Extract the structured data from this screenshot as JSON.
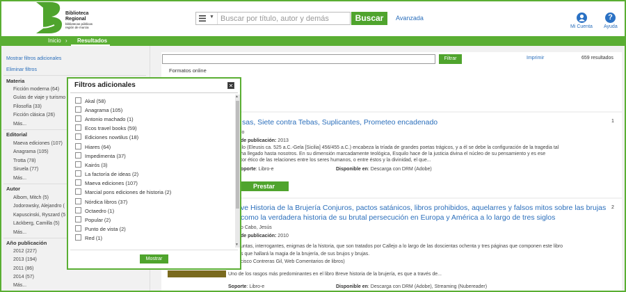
{
  "header": {
    "logo_line1": "Biblioteca",
    "logo_line2": "Regional",
    "logo_sub1": "bibliotecas públicas",
    "logo_sub2": "región de murcia",
    "search_placeholder": "Buscar por título, autor y demás",
    "search_button": "Buscar",
    "advanced": "Avanzada",
    "account": "Mi Cuenta",
    "help": "Ayuda",
    "help_glyph": "?"
  },
  "nav": {
    "home": "Inicio",
    "separator": "›",
    "results": "Resultados"
  },
  "sidebar": {
    "show_filters": "Mostrar filtros adicionales",
    "remove_filters": "Eliminar filtros",
    "sections": [
      {
        "title": "Materia",
        "items": [
          "Ficción moderna (64)",
          "Guías de viaje y turismo",
          "Filosofía (33)",
          "Ficción clásica (26)",
          "Más..."
        ]
      },
      {
        "title": "Editorial",
        "items": [
          "Maeva ediciones (107)",
          "Anagrama (105)",
          "Trotta (78)",
          "Siruela (77)",
          "Más..."
        ]
      },
      {
        "title": "Autor",
        "items": [
          "Albom, Mitch (5)",
          "Jodorowsky, Alejandro (",
          "Kapuscinski, Ryszard (5",
          "Läckberg, Camilla (5)",
          "Más..."
        ]
      },
      {
        "title": "Año publicación",
        "items": [
          "2012 (227)",
          "2013 (194)",
          "2011 (86)",
          "2014 (57)",
          "Más..."
        ]
      }
    ]
  },
  "main": {
    "filter_button": "Filtrar",
    "print": "Imprimir",
    "results_count": "659 resultados",
    "formats": "Formatos online",
    "results": [
      {
        "number": "1",
        "title": "sas, Siete contra Tebas, Suplicantes, Prometeo encadenado",
        "author": "lo",
        "pub_label": "de publicación:",
        "pub_year": "2013",
        "desc1": "ilo (Eleusis ca. 525 a.C.-Gela [Sicilia] 456/455 a.C.) encabeza la tríada de grandes poetas trágicos, y a él se debe la configuración de la tragedia tal",
        "desc2": "ha llegado hasta nosotros. En su dimensión marcadamente teológica, Esquilo hace de la justicia divina el núcleo de su pensamiento y es ese",
        "desc3": "tor ético de las relaciones entre los seres humanos, o entre éstos y la divinidad, el que...",
        "support_label": "oporte",
        "support": ": Libro-e",
        "avail_label": "Disponible en",
        "avail": ": Descarga con DRM (Adobe)",
        "lend": "Prestar"
      },
      {
        "number": "2",
        "title_line1": "ve Historia de la Brujería Conjuros, pactos satánicos, libros prohibidos, aquelarres y falsos mitos sobre las brujas",
        "title_line2": "como la verdadera historia de su brutal persecución en Europa y América a lo largo de tres siglos",
        "author": "o Cabo, Jesús",
        "pub_label": "de publicación:",
        "pub_year": "2010",
        "desc1": "untas, interrogantes, enigmas de la historia, que son tratados por Callejo a lo largo de las doscientas ochenta y tres páginas que componen este libro",
        "desc2": "s que hallará la magia de la brujería, de sus brujos y brujas.",
        "desc3": "cisco Contreras Gil, Web Comentarios de libros)",
        "desc4": "Uno de los rasgos más predominantes en el libro Breve historia de la brujería, es que a través de...",
        "support_label": "Soporte",
        "support": ": Libro-e",
        "avail_label": "Disponible en",
        "avail": ": Descarga con DRM (Adobe), Streaming (Nubereader)"
      }
    ]
  },
  "modal": {
    "title": "Filtros adicionales",
    "close": "✕",
    "options": [
      "Akal (58)",
      "Anagrama (105)",
      "Antonio machado (1)",
      "Ecos travel books (59)",
      "Ediciones nowtilus (18)",
      "Hiares (64)",
      "Impedimenta (37)",
      "Kairós (3)",
      "La factoría de ideas (2)",
      "Maeva ediciones (107)",
      "Marcial pons ediciones de historia (2)",
      "Nórdica libros (37)",
      "Octaedro (1)",
      "Popular (2)",
      "Punto de vista (2)",
      "Red (1)"
    ],
    "show_button": "Mostrar"
  },
  "colors": {
    "brand_green": "#5aae33",
    "button_green": "#4fa42d",
    "link_blue": "#2a6ebb"
  }
}
